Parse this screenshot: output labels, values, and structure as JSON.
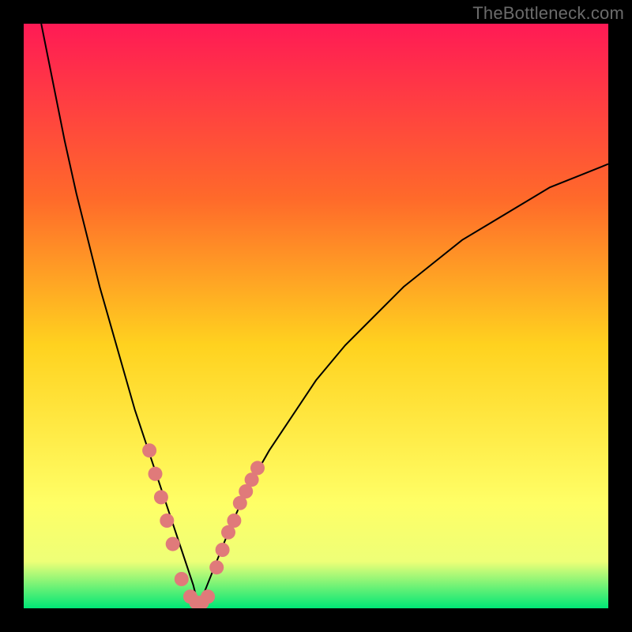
{
  "watermark": "TheBottleneck.com",
  "colors": {
    "page_bg": "#000000",
    "grad_top": "#ff1a55",
    "grad_mid1": "#ff6a2a",
    "grad_mid2": "#ffd21f",
    "grad_mid3": "#ffff66",
    "grad_bot": "#00e676",
    "curve": "#000000",
    "dot_fill": "#e07a7a",
    "dot_stroke": "#b94d4d"
  },
  "chart_data": {
    "type": "line",
    "title": "",
    "xlabel": "",
    "ylabel": "",
    "xlim": [
      0,
      100
    ],
    "ylim": [
      0,
      100
    ],
    "notes": "Gradient background from red (top, high bottleneck) to green (bottom, low bottleneck). Curve is absolute bottleneck percentage vs. relative component capability. Salmon dots mark sampled configurations clustered near the minimum.",
    "series": [
      {
        "name": "bottleneck-curve",
        "x": [
          3,
          5,
          7,
          9,
          11,
          13,
          15,
          17,
          19,
          21,
          23,
          25,
          27,
          29,
          30,
          31,
          33,
          35,
          38,
          42,
          46,
          50,
          55,
          60,
          65,
          70,
          75,
          80,
          85,
          90,
          95,
          100
        ],
        "values": [
          100,
          90,
          80,
          71,
          63,
          55,
          48,
          41,
          34,
          28,
          22,
          16,
          10,
          4,
          0,
          3,
          8,
          13,
          20,
          27,
          33,
          39,
          45,
          50,
          55,
          59,
          63,
          66,
          69,
          72,
          74,
          76
        ]
      }
    ],
    "points": {
      "name": "sample-dots",
      "x": [
        21.5,
        22.5,
        23.5,
        24.5,
        25.5,
        27.0,
        28.5,
        29.5,
        30.5,
        31.5,
        33.0,
        34.0,
        35.0,
        36.0,
        37.0,
        38.0,
        39.0,
        40.0
      ],
      "values": [
        27,
        23,
        19,
        15,
        11,
        5,
        2,
        1,
        1,
        2,
        7,
        10,
        13,
        15,
        18,
        20,
        22,
        24
      ]
    }
  }
}
